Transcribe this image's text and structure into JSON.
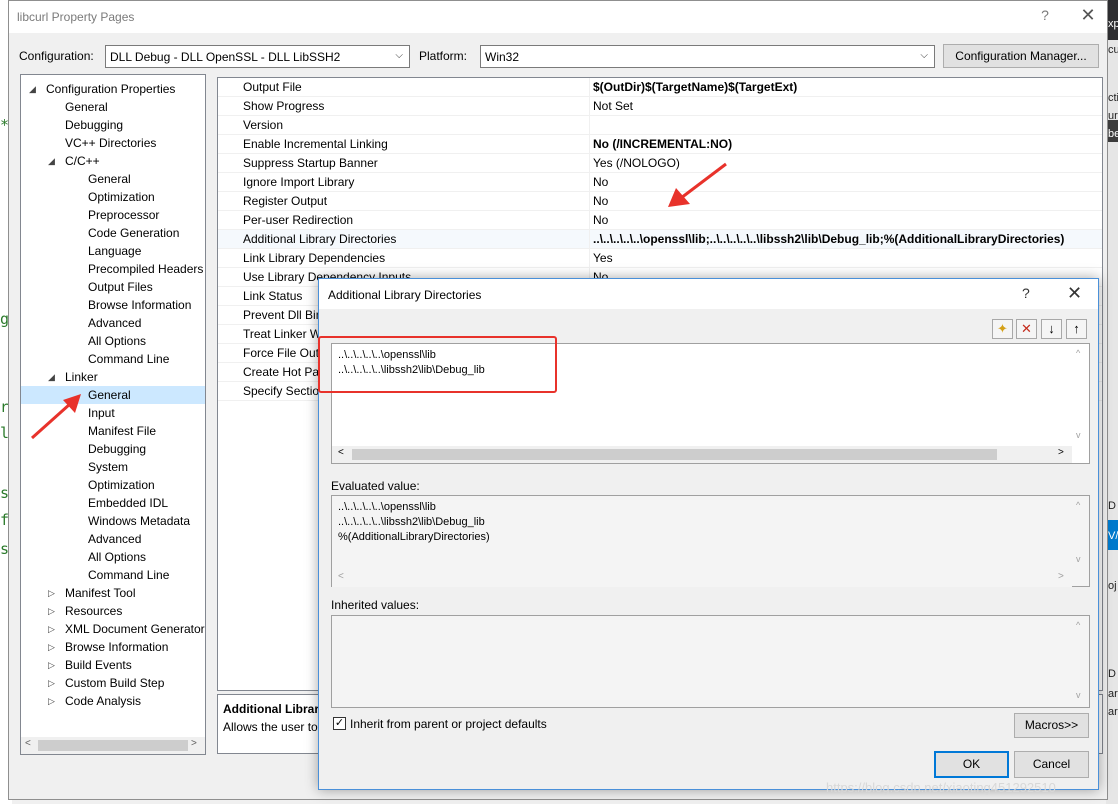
{
  "window": {
    "title": "libcurl Property Pages",
    "help": "?",
    "close": "✕"
  },
  "config": {
    "configuration_label": "Configuration:",
    "configuration_value": "DLL Debug - DLL OpenSSL - DLL LibSSH2",
    "platform_label": "Platform:",
    "platform_value": "Win32",
    "manager_button": "Configuration Manager..."
  },
  "tree": {
    "items": [
      {
        "label": "Configuration Properties",
        "toggle": "◢"
      },
      {
        "label": "General"
      },
      {
        "label": "Debugging"
      },
      {
        "label": "VC++ Directories"
      },
      {
        "label": "C/C++",
        "toggle": "◢"
      },
      {
        "label": "General"
      },
      {
        "label": "Optimization"
      },
      {
        "label": "Preprocessor"
      },
      {
        "label": "Code Generation"
      },
      {
        "label": "Language"
      },
      {
        "label": "Precompiled Headers"
      },
      {
        "label": "Output Files"
      },
      {
        "label": "Browse Information"
      },
      {
        "label": "Advanced"
      },
      {
        "label": "All Options"
      },
      {
        "label": "Command Line"
      },
      {
        "label": "Linker",
        "toggle": "◢"
      },
      {
        "label": "General"
      },
      {
        "label": "Input"
      },
      {
        "label": "Manifest File"
      },
      {
        "label": "Debugging"
      },
      {
        "label": "System"
      },
      {
        "label": "Optimization"
      },
      {
        "label": "Embedded IDL"
      },
      {
        "label": "Windows Metadata"
      },
      {
        "label": "Advanced"
      },
      {
        "label": "All Options"
      },
      {
        "label": "Command Line"
      },
      {
        "label": "Manifest Tool",
        "toggle": "▷"
      },
      {
        "label": "Resources",
        "toggle": "▷"
      },
      {
        "label": "XML Document Generator",
        "toggle": "▷"
      },
      {
        "label": "Browse Information",
        "toggle": "▷"
      },
      {
        "label": "Build Events",
        "toggle": "▷"
      },
      {
        "label": "Custom Build Step",
        "toggle": "▷"
      },
      {
        "label": "Code Analysis",
        "toggle": "▷"
      }
    ]
  },
  "grid": {
    "rows": [
      {
        "name": "Output File",
        "value": "$(OutDir)$(TargetName)$(TargetExt)",
        "bold": true
      },
      {
        "name": "Show Progress",
        "value": "Not Set"
      },
      {
        "name": "Version",
        "value": ""
      },
      {
        "name": "Enable Incremental Linking",
        "value": "No (/INCREMENTAL:NO)",
        "bold": true
      },
      {
        "name": "Suppress Startup Banner",
        "value": "Yes (/NOLOGO)"
      },
      {
        "name": "Ignore Import Library",
        "value": "No"
      },
      {
        "name": "Register Output",
        "value": "No"
      },
      {
        "name": "Per-user Redirection",
        "value": "No"
      },
      {
        "name": "Additional Library Directories",
        "value": "..\\..\\..\\..\\..\\openssl\\lib;..\\..\\..\\..\\..\\libssh2\\lib\\Debug_lib;%(AdditionalLibraryDirectories)",
        "bold": true
      },
      {
        "name": "Link Library Dependencies",
        "value": "Yes"
      },
      {
        "name": "Use Library Dependency Inputs",
        "value": "No"
      },
      {
        "name": "Link Status",
        "value": ""
      },
      {
        "name": "Prevent Dll Binding",
        "value": ""
      },
      {
        "name": "Treat Linker Warning As Errors",
        "value": ""
      },
      {
        "name": "Force File Output",
        "value": ""
      },
      {
        "name": "Create Hot Patchable Image",
        "value": ""
      },
      {
        "name": "Specify Section Attributes",
        "value": ""
      }
    ]
  },
  "description": {
    "title": "Additional Library Directories",
    "text": "Allows the user to override the environmental library path."
  },
  "dialog": {
    "title": "Additional Library Directories",
    "help": "?",
    "close": "✕",
    "toolbar": {
      "new_line_icon": "✦",
      "delete_icon": "✕",
      "move_down_icon": "↓",
      "move_up_icon": "↑"
    },
    "edit_lines": [
      "..\\..\\..\\..\\..\\openssl\\lib",
      "..\\..\\..\\..\\..\\libssh2\\lib\\Debug_lib"
    ],
    "evaluated_label": "Evaluated value:",
    "evaluated_lines": [
      "..\\..\\..\\..\\..\\openssl\\lib",
      "..\\..\\..\\..\\..\\libssh2\\lib\\Debug_lib",
      "%(AdditionalLibraryDirectories)"
    ],
    "inherited_label": "Inherited values:",
    "inherit_checkbox": "Inherit from parent or project defaults",
    "inherit_checked": "✓",
    "macros_button": "Macros>>",
    "ok_button": "OK",
    "cancel_button": "Cancel"
  },
  "background": {
    "left_code": [
      "*",
      "g",
      "r",
      "l",
      "s",
      "f",
      "s"
    ],
    "right_text": [
      "xp",
      "cu",
      "cti",
      "ur",
      "be",
      "D",
      "V/",
      "oj",
      "D",
      "ar",
      "ar"
    ]
  },
  "watermark": "https://blog.csdn.net/xiaoting451292510",
  "scroll": {
    "left": "<",
    "right": ">",
    "up": "^",
    "down": "v"
  },
  "colors": {
    "selection": "#cce8ff",
    "annotation_red": "#e8322b",
    "dialog_border": "#4a90d9"
  }
}
